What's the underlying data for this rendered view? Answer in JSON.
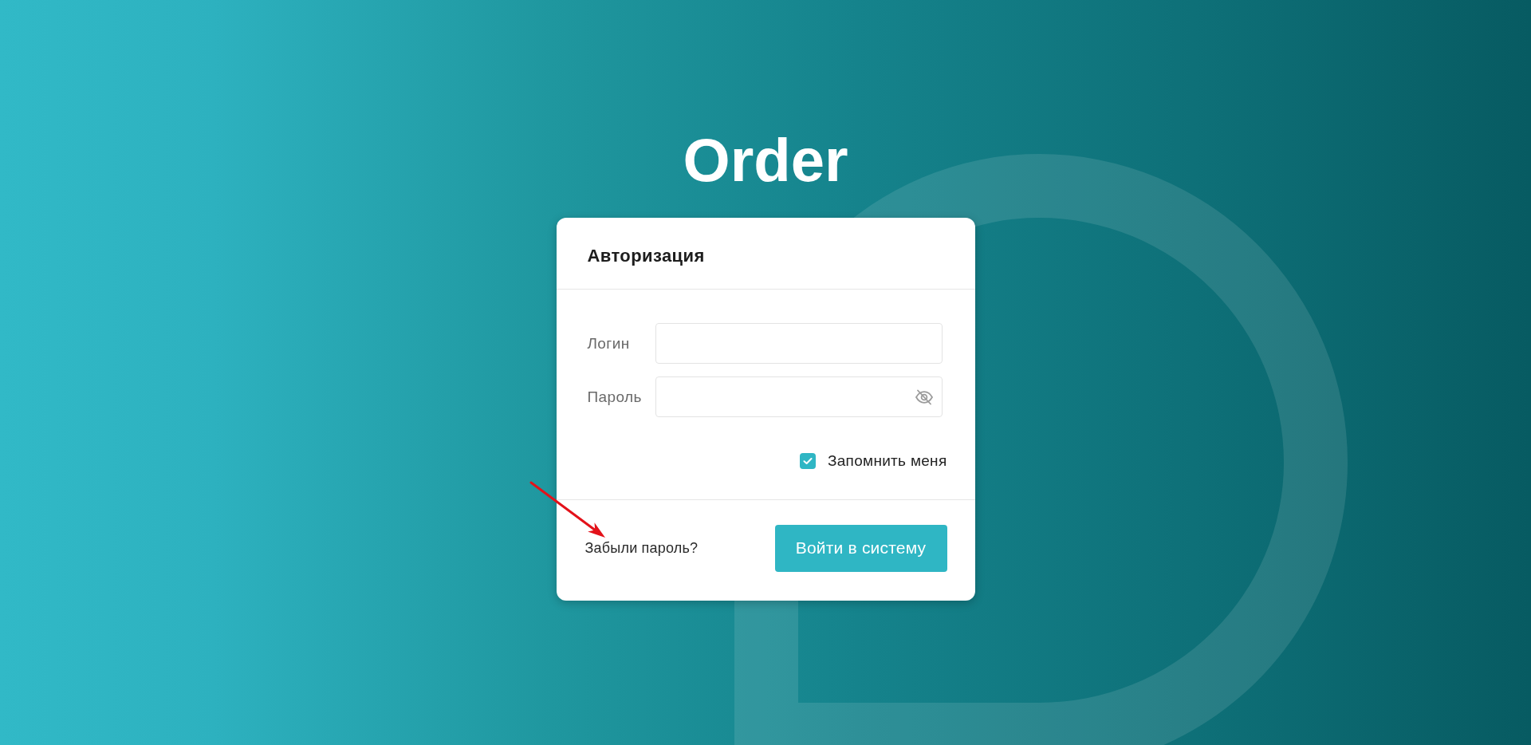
{
  "app_title": "Order",
  "login_card": {
    "title": "Авторизация",
    "fields": [
      {
        "kind": "text",
        "label": "Логин"
      },
      {
        "kind": "password",
        "label": "Пароль"
      }
    ],
    "remember_me": {
      "label": "Запомнить меня",
      "checked": true
    },
    "forgot_password_link": "Забыли пароль?",
    "submit_button": "Войти в систему"
  }
}
